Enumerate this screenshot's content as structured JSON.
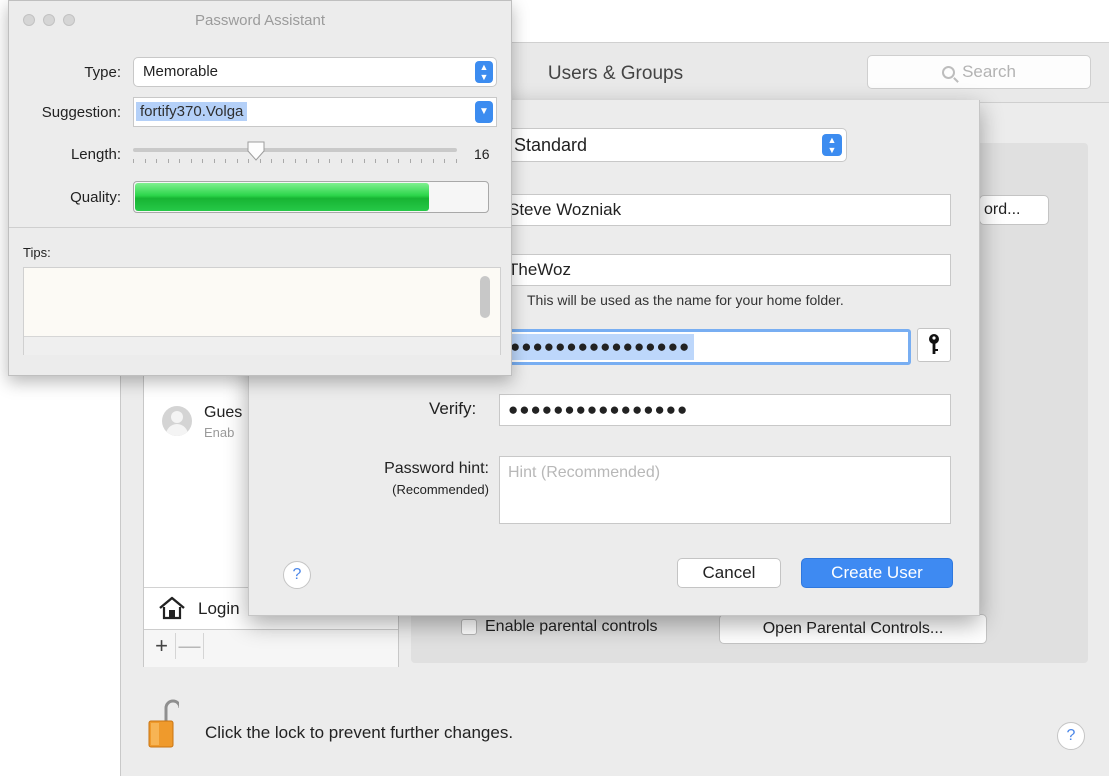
{
  "users_groups": {
    "window_title": "Users & Groups",
    "search_placeholder": "Search",
    "reset_password_button": "ord...",
    "users_list": {
      "guest": {
        "name": "Gues",
        "status": "Enab"
      },
      "login_options": "Login",
      "add": "+",
      "remove": "—"
    },
    "parental_controls_checkbox": "Enable parental controls",
    "open_parental_controls_button": "Open Parental Controls...",
    "lock_text": "Click the lock to prevent further changes.",
    "help": "?"
  },
  "new_user_sheet": {
    "account_type": "Standard",
    "full_name": "Steve Wozniak",
    "account_name": "TheWoz",
    "account_name_note": "This will be used as the name for your home folder.",
    "password_masked": "●●●●●●●●●●●●●●●●",
    "verify_label": "Verify:",
    "verify_masked": "●●●●●●●●●●●●●●●●",
    "hint_label": "Password hint:",
    "hint_sub_label": "(Recommended)",
    "hint_placeholder": "Hint (Recommended)",
    "help": "?",
    "cancel_button": "Cancel",
    "create_button": "Create User"
  },
  "password_assistant": {
    "title": "Password Assistant",
    "type_label": "Type:",
    "type_value": "Memorable",
    "suggestion_label": "Suggestion:",
    "suggestion_value": "fortify370.Volga",
    "length_label": "Length:",
    "length_value": "16",
    "length_fraction": 0.38,
    "quality_label": "Quality:",
    "quality_fraction": 0.83,
    "quality_color": "#2bd54a",
    "tips_label": "Tips:"
  }
}
